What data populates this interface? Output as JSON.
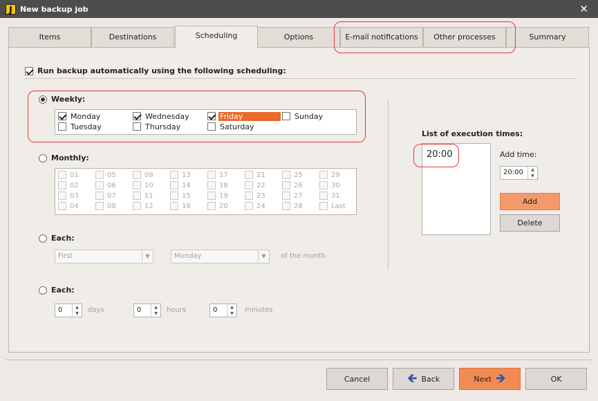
{
  "window": {
    "title": "New backup job",
    "app_icon": "J",
    "close_glyph": "✕"
  },
  "tabs": [
    {
      "label": "Items"
    },
    {
      "label": "Destinations"
    },
    {
      "label": "Scheduling"
    },
    {
      "label": "Options"
    },
    {
      "label": "E-mail notifications"
    },
    {
      "label": "Other processes"
    },
    {
      "label": "Summary"
    }
  ],
  "active_tab": "Scheduling",
  "auto": {
    "label": "Run backup automatically using the following scheduling:",
    "checked": true
  },
  "weekly": {
    "label": "Weekly:",
    "selected": true,
    "days": [
      {
        "label": "Monday",
        "checked": true
      },
      {
        "label": "Wednesday",
        "checked": true
      },
      {
        "label": "Friday",
        "checked": true
      },
      {
        "label": "Sunday",
        "checked": false
      },
      {
        "label": "Tuesday",
        "checked": false
      },
      {
        "label": "Thursday",
        "checked": false
      },
      {
        "label": "Saturday",
        "checked": false
      }
    ]
  },
  "monthly": {
    "label": "Monthly:",
    "selected": false,
    "days": [
      "01",
      "05",
      "09",
      "13",
      "17",
      "21",
      "25",
      "29",
      "02",
      "06",
      "10",
      "14",
      "18",
      "22",
      "26",
      "30",
      "03",
      "07",
      "11",
      "15",
      "19",
      "23",
      "27",
      "31",
      "04",
      "08",
      "12",
      "16",
      "20",
      "24",
      "28",
      "Last"
    ]
  },
  "each_month": {
    "label": "Each:",
    "first_value": "First",
    "day_value": "Monday",
    "suffix": "of the month"
  },
  "each_interval": {
    "label": "Each:",
    "days_value": "0",
    "days_label": "days",
    "hours_value": "0",
    "hours_label": "hours",
    "minutes_value": "0",
    "minutes_label": "minutes"
  },
  "exec_times": {
    "title": "List of execution times:",
    "items": [
      "20:00"
    ],
    "add_time_label": "Add time:",
    "add_time_value": "20:00",
    "add_button": "Add",
    "delete_button": "Delete"
  },
  "footer": {
    "cancel": "Cancel",
    "back": "Back",
    "next": "Next",
    "ok": "OK"
  },
  "colors": {
    "accent": "#ea6a2a",
    "highlight_ring": "#e03a3a",
    "titlebar": "#4d4d4d"
  }
}
